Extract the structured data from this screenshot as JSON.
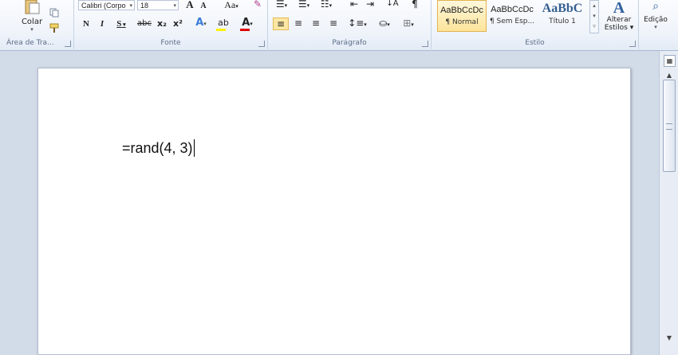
{
  "clipboard": {
    "paste_label": "Colar",
    "group_label": "Área de Tra..."
  },
  "font": {
    "family": "Calibri (Corpo",
    "size": "18",
    "grow": "A",
    "shrink": "A",
    "case": "Aa",
    "bold": "N",
    "italic": "I",
    "underline": "S",
    "strike": "abc",
    "subscript": "x₂",
    "superscript": "x²",
    "group_label": "Fonte"
  },
  "paragraph": {
    "group_label": "Parágrafo",
    "pilcrow": "¶"
  },
  "styles": {
    "items": [
      {
        "preview": "AaBbCcDc",
        "name": "¶ Normal"
      },
      {
        "preview": "AaBbCcDc",
        "name": "¶ Sem Esp..."
      },
      {
        "preview": "AaBbC",
        "name": "Título 1"
      }
    ],
    "change_label_1": "Alterar",
    "change_label_2": "Estilos",
    "group_label": "Estilo"
  },
  "editing": {
    "label": "Edição"
  },
  "document": {
    "text": "=rand(4, 3)"
  },
  "colors": {
    "highlight": "#fff200",
    "font_color": "#e00000",
    "heading_blue": "#365f91"
  }
}
